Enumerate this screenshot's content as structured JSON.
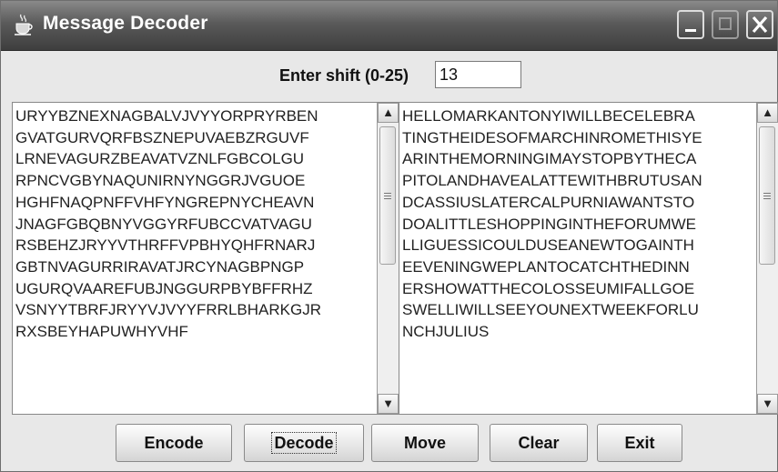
{
  "window": {
    "title": "Message Decoder",
    "icon": "java-cup-icon"
  },
  "shift": {
    "label": "Enter shift (0-25)",
    "value": "13"
  },
  "encoded_lines": [
    "URYYBZNEXNAGBALVJVYYORPRYRBEN",
    "GVATGURVQRFBSZNEPUVAEBZRGUVF",
    "LRNEVAGURZBEAVATVZNLFGBCOLGU",
    "RPNCVGBYNAQUNIRNYNGGRJVGUOE",
    "HGHFNAQPNFFVHFYNGREPNYCHEAVN",
    "JNAGFGBQBNYVGGYRFUBCCVATVAGU",
    "RSBEHZJRYYVTHRFFVPBHYQHFRNARJ",
    "GBTNVAGURRIRAVATJRCYNAGBPNGP",
    "UGURQVAAREFUBJNGGURPBYBFFRHZ",
    "VSNYYTBRFJRYYVJVYYFRRLBHARKGJR",
    "RXSBEYHAPUWHYVHF"
  ],
  "decoded_lines": [
    "HELLOMARKANTONYIWILLBECELEBRA",
    "TINGTHEIDESOFMARCHINROMETHISYE",
    "ARINTHEMORNINGIMAYSTOPBYTHECA",
    "PITOLANDHAVEALATTEWITHBRUTUSAN",
    "DCASSIUSLATERCALPURNIAWANTSTO",
    "DOALITTLESHOPPINGINTHEFORUMWE",
    "LLIGUESSICOULDUSEANEWTOGAINTH",
    "EEVENINGWEPLANTOCATCHTHEDINN",
    "ERSHOWATTHECOLOSSEUMIFALLGOE",
    "SWELLIWILLSEEYOUNEXTWEEKFORLU",
    "NCHJULIUS"
  ],
  "buttons": {
    "encode": "Encode",
    "decode": "Decode",
    "move": "Move",
    "clear": "Clear",
    "exit": "Exit"
  },
  "scrollbar": {
    "up_arrow": "▲",
    "down_arrow": "▼"
  }
}
